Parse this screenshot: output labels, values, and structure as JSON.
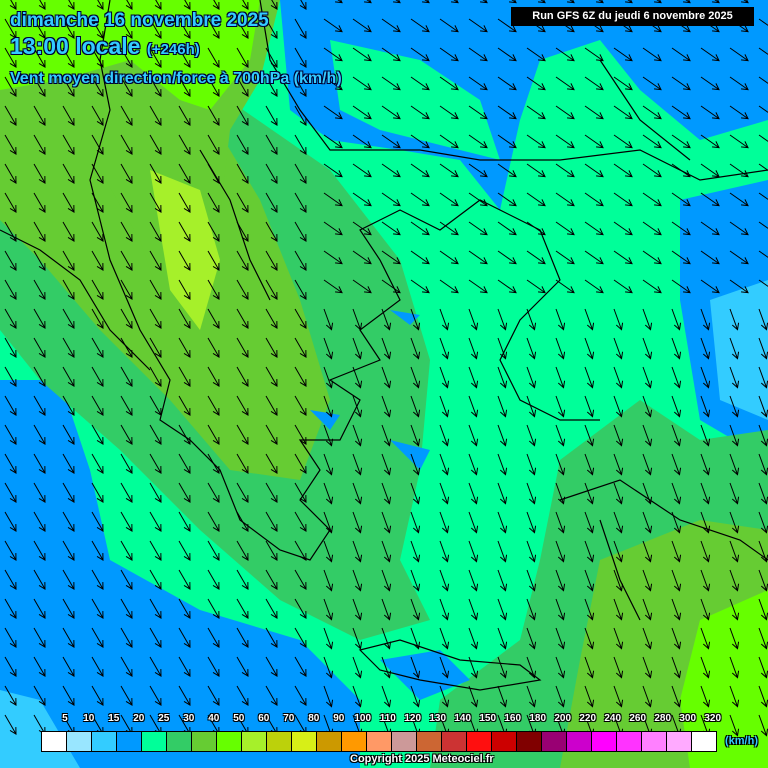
{
  "header": {
    "date": "dimanche 16 novembre 2025",
    "time": "13:00 locale",
    "lead": "(+246h)",
    "parameter": "Vent moyen direction/force à 700hPa (km/h)",
    "run": "Run GFS 6Z du jeudi 6 novembre 2025"
  },
  "legend": {
    "unit": "(km/h)",
    "labels": [
      "5",
      "10",
      "15",
      "20",
      "25",
      "30",
      "40",
      "50",
      "60",
      "70",
      "80",
      "90",
      "100",
      "110",
      "120",
      "130",
      "140",
      "150",
      "160",
      "180",
      "200",
      "220",
      "240",
      "260",
      "280",
      "300",
      "320"
    ],
    "colors": [
      "#ffffff",
      "#99e6ff",
      "#33ccff",
      "#0099ff",
      "#00ff99",
      "#33cc66",
      "#66cc33",
      "#66ff00",
      "#a6f02a",
      "#bcd10b",
      "#d7ef17",
      "#cc9900",
      "#ff9900",
      "#ff9966",
      "#cc9999",
      "#cc6633",
      "#cc3333",
      "#ff0f0f",
      "#cc0000",
      "#800000",
      "#990073",
      "#cc00cc",
      "#ff00ff",
      "#ff33ff",
      "#ff80ff",
      "#ffaaff",
      "#ffffff"
    ]
  },
  "footer": {
    "copyright": "Copyright 2025 Meteociel.fr"
  }
}
